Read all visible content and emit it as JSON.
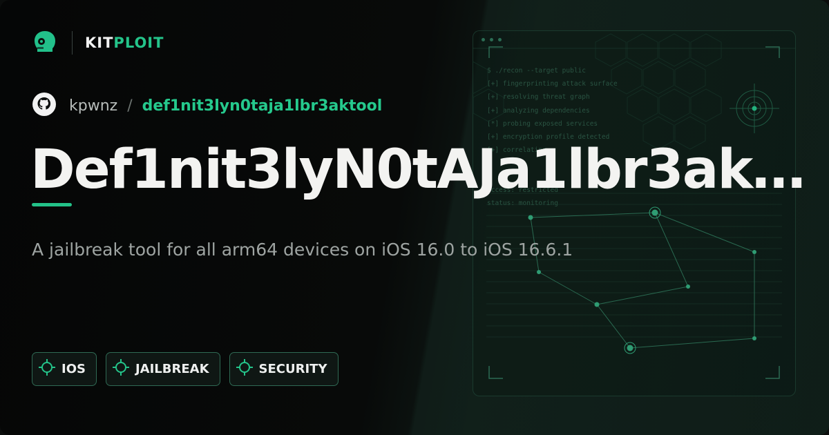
{
  "brand": {
    "name_part1": "KIT",
    "name_part2": "PLOIT",
    "logo_icon": "kitploit-helmet-icon"
  },
  "repo": {
    "icon": "github-icon",
    "owner": "kpwnz",
    "separator": "/",
    "name": "def1nit3lyn0taja1lbr3aktool"
  },
  "title": "Def1nit3lyN0tAJa1lbr3ak…",
  "description": "A jailbreak tool for all arm64 devices on iOS 16.0 to iOS 16.6.1",
  "tags": [
    {
      "label": "IOS",
      "icon": "crosshair-icon"
    },
    {
      "label": "JAILBREAK",
      "icon": "crosshair-icon"
    },
    {
      "label": "SECURITY",
      "icon": "crosshair-icon"
    }
  ],
  "terminal": {
    "lines": [
      "$ ./recon --target public",
      "[+] fingerprinting attack surface",
      "[+] resolving threat graph",
      "[+] analyzing dependencies",
      "[*] probing exposed services",
      "[+] encryption profile detected",
      "[+] correlating",
      "",
      "",
      "access: restricted",
      "status: monitoring"
    ]
  },
  "colors": {
    "accent": "#24c48a",
    "background": "#080a09",
    "title": "#f3f3f1",
    "muted": "#9ea4a2"
  }
}
